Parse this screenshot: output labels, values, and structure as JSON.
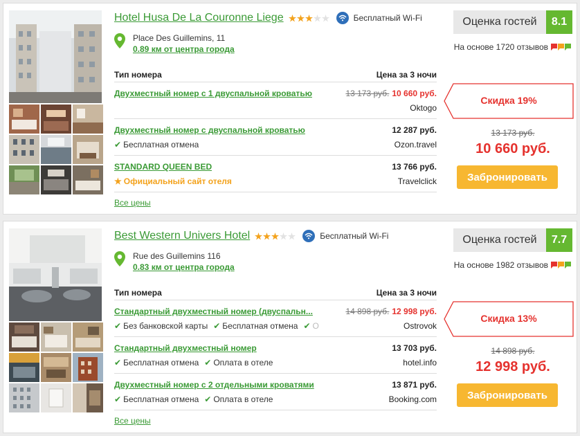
{
  "hotels": [
    {
      "name": "Hotel Husa De La Couronne Liege",
      "stars": 3,
      "wifi": "Бесплатный Wi-Fi",
      "address": "Place Des Guillemins, 11",
      "distance": "0.89 км от центра города",
      "rating_label": "Оценка гостей",
      "rating_score": "8.1",
      "reviews": "На основе 1720 отзывов",
      "col_room": "Тип номера",
      "col_price": "Цена за 3 ночи",
      "rooms": [
        {
          "name": "Двухместный номер с 1 двуспальной кроватью",
          "old_price": "13 173 руб.",
          "price": "10 660 руб.",
          "provider": "Oktogo",
          "features": []
        },
        {
          "name": "Двухместный номер с двуспальной кроватью",
          "old_price": "",
          "price": "12 287 руб.",
          "provider": "Ozon.travel",
          "features": [
            "Бесплатная отмена"
          ]
        },
        {
          "name": "STANDARD QUEEN BED",
          "old_price": "",
          "price": "13 766 руб.",
          "provider": "Travelclick",
          "features": [],
          "official": "Официальный сайт отеля"
        }
      ],
      "discount": "Скидка 19%",
      "side_old_price": "13 173 руб.",
      "side_price": "10 660 руб.",
      "book_label": "Забронировать",
      "all_prices": "Все цены"
    },
    {
      "name": "Best Western Univers Hotel",
      "stars": 3,
      "wifi": "Бесплатный Wi-Fi",
      "address": "Rue des Guillemins 116",
      "distance": "0.83 км от центра города",
      "rating_label": "Оценка гостей",
      "rating_score": "7.7",
      "reviews": "На основе 1982 отзывов",
      "col_room": "Тип номера",
      "col_price": "Цена за 3 ночи",
      "rooms": [
        {
          "name": "Стандартный двухместный номер (двуспальн...",
          "old_price": "14 898 руб.",
          "price": "12 998 руб.",
          "provider": "Ostrovok",
          "features": [
            "Без банковской карты",
            "Бесплатная отмена",
            "О"
          ]
        },
        {
          "name": "Стандартный двухместный номер",
          "old_price": "",
          "price": "13 703 руб.",
          "provider": "hotel.info",
          "features": [
            "Бесплатная отмена",
            "Оплата в отеле"
          ]
        },
        {
          "name": "Двухместный номер с 2 отдельными кроватями",
          "old_price": "",
          "price": "13 871 руб.",
          "provider": "Booking.com",
          "features": [
            "Бесплатная отмена",
            "Оплата в отеле"
          ]
        }
      ],
      "discount": "Скидка 13%",
      "side_old_price": "14 898 руб.",
      "side_price": "12 998 руб.",
      "book_label": "Забронировать",
      "all_prices": "Все цены"
    }
  ],
  "colors": {
    "green_link": "#3a9a35",
    "rating_green": "#65b831",
    "price_red": "#e5322e",
    "button_yellow": "#f7b731",
    "star_gold": "#f3a21c",
    "wifi_blue": "#2f6fb9"
  }
}
